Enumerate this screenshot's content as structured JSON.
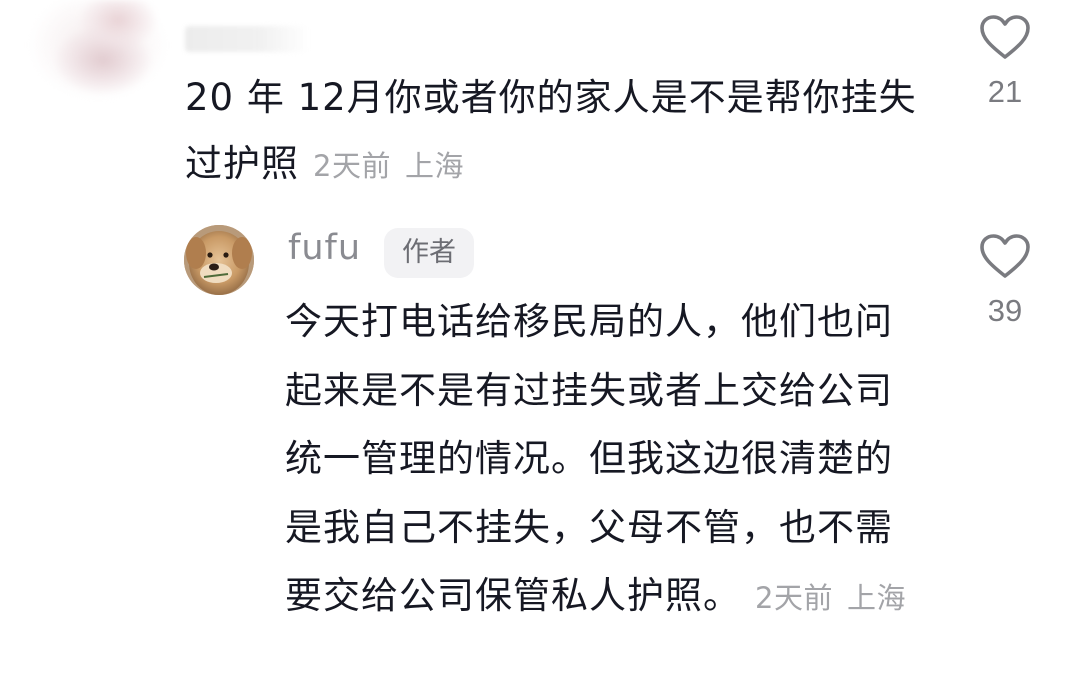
{
  "top_comment": {
    "text": "20 年 12月你或者你的家人是不是帮你挂失过护照",
    "time": "2天前",
    "location": "上海",
    "likes": "21"
  },
  "reply": {
    "username": "fufu",
    "badge": "作者",
    "text": "今天打电话给移民局的人，他们也问起来是不是有过挂失或者上交给公司统一管理的情况。但我这边很清楚的是我自己不挂失，父母不管，也不需要交给公司保管私人护照。",
    "time": "2天前",
    "location": "上海",
    "likes": "39"
  },
  "icons": {
    "like": "heart-outline-icon",
    "avatar": "dog-avatar"
  },
  "colors": {
    "text": "#161823",
    "meta": "#a3a4a8",
    "username": "#8a8b91",
    "badge_bg": "#f2f2f4"
  }
}
